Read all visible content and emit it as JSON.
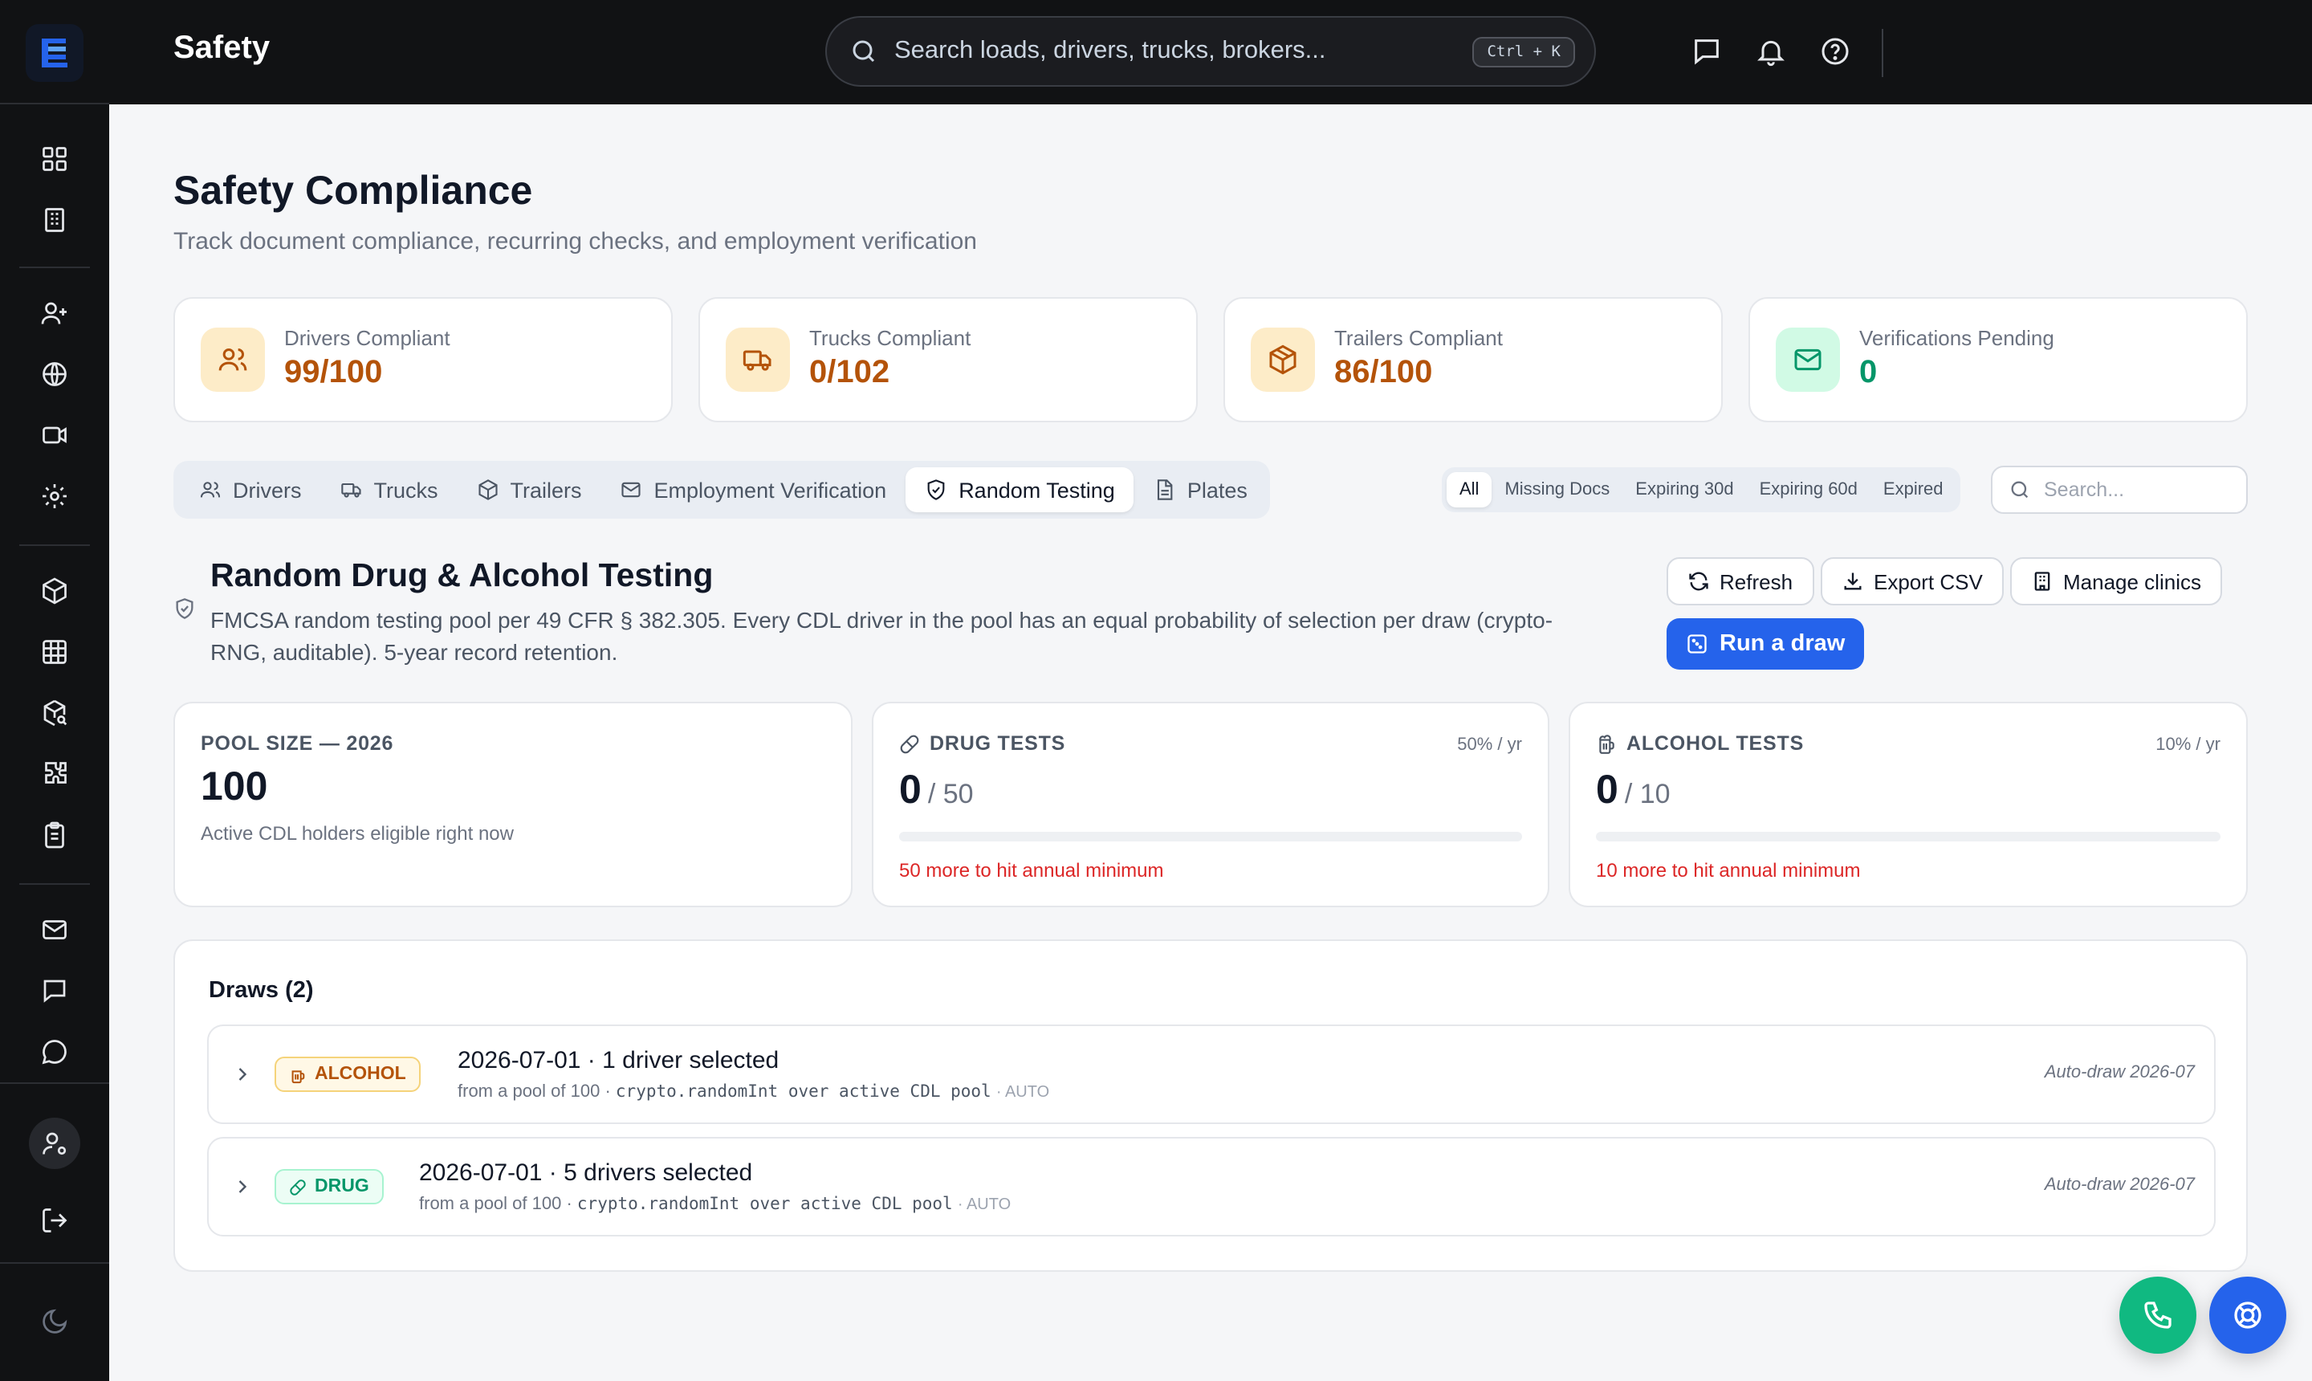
{
  "topbar": {
    "title": "Safety",
    "search_placeholder": "Search loads, drivers, trucks, brokers...",
    "shortcut": "Ctrl + K"
  },
  "page": {
    "title": "Safety Compliance",
    "subtitle": "Track document compliance, recurring checks, and employment verification"
  },
  "kpis": [
    {
      "label": "Drivers Compliant",
      "value": "99/100",
      "icon": "users-icon",
      "color": "#b45309",
      "bg": "#fdecc8"
    },
    {
      "label": "Trucks Compliant",
      "value": "0/102",
      "icon": "truck-icon",
      "color": "#b45309",
      "bg": "#fdecc8"
    },
    {
      "label": "Trailers Compliant",
      "value": "86/100",
      "icon": "box-icon",
      "color": "#b45309",
      "bg": "#fdecc8"
    },
    {
      "label": "Verifications Pending",
      "value": "0",
      "icon": "mail-icon",
      "color": "#059669",
      "bg": "#d1fae5"
    }
  ],
  "tabs": [
    {
      "label": "Drivers",
      "icon": "users-icon"
    },
    {
      "label": "Trucks",
      "icon": "truck-icon"
    },
    {
      "label": "Trailers",
      "icon": "box-icon"
    },
    {
      "label": "Employment Verification",
      "icon": "mail-icon"
    },
    {
      "label": "Random Testing",
      "icon": "shield-icon",
      "active": true
    },
    {
      "label": "Plates",
      "icon": "document-icon"
    }
  ],
  "filters": [
    "All",
    "Missing Docs",
    "Expiring 30d",
    "Expiring 60d",
    "Expired"
  ],
  "active_filter": "All",
  "table_search_placeholder": "Search...",
  "section": {
    "title": "Random Drug & Alcohol Testing",
    "description": "FMCSA random testing pool per 49 CFR § 382.305. Every CDL driver in the pool has an equal probability of selection per draw (crypto-RNG, auditable). 5-year record retention."
  },
  "actions": {
    "refresh": "Refresh",
    "export": "Export CSV",
    "clinics": "Manage clinics",
    "run_draw": "Run a draw"
  },
  "stats": {
    "pool": {
      "label": "POOL SIZE — 2026",
      "value": "100",
      "note": "Active CDL holders eligible right now"
    },
    "drug": {
      "label": "DRUG TESTS",
      "rate": "50% / yr",
      "done": "0",
      "target": "/ 50",
      "progress": 0,
      "warning": "50 more to hit annual minimum"
    },
    "alcohol": {
      "label": "ALCOHOL TESTS",
      "rate": "10% / yr",
      "done": "0",
      "target": "/ 10",
      "progress": 0,
      "warning": "10 more to hit annual minimum"
    }
  },
  "draws": {
    "title": "Draws (2)",
    "items": [
      {
        "type": "ALCOHOL",
        "headline": "2026-07-01 · 1 driver selected",
        "pool_text": "from a pool of 100 ·",
        "method": "crypto.randomInt over active CDL pool",
        "mode": "· AUTO",
        "tag": "Auto-draw 2026-07"
      },
      {
        "type": "DRUG",
        "headline": "2026-07-01 · 5 drivers selected",
        "pool_text": "from a pool of 100 ·",
        "method": "crypto.randomInt over active CDL pool",
        "mode": "· AUTO",
        "tag": "Auto-draw 2026-07"
      }
    ]
  },
  "colors": {
    "accent": "#2563eb",
    "phone_fab": "#10b981",
    "help_fab": "#2563eb",
    "warning": "#dc2626"
  }
}
